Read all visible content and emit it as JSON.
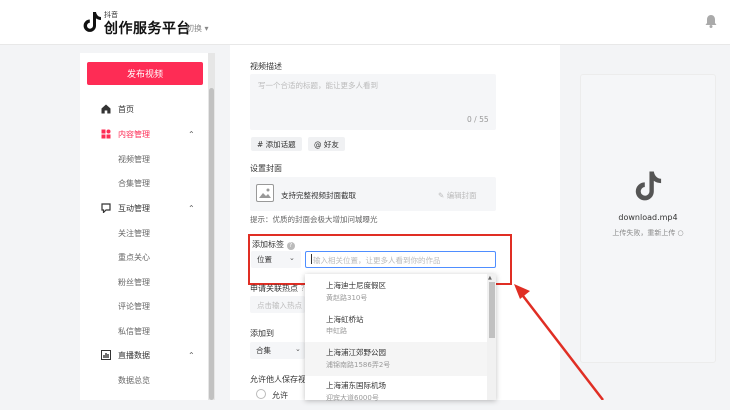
{
  "header": {
    "brand_small": "抖音",
    "brand_title": "创作服务平台",
    "switch_label": "切换",
    "switch_caret": "▾"
  },
  "sidebar": {
    "publish_button": "发布视频",
    "items": [
      {
        "label": "首页",
        "icon": "home-icon"
      },
      {
        "label": "内容管理",
        "icon": "grid-icon",
        "caret": "⌃",
        "active": true
      },
      {
        "label": "视频管理"
      },
      {
        "label": "合集管理"
      },
      {
        "label": "互动管理",
        "icon": "interaction-icon",
        "caret": "⌃"
      },
      {
        "label": "关注管理"
      },
      {
        "label": "重点关心"
      },
      {
        "label": "粉丝管理"
      },
      {
        "label": "评论管理"
      },
      {
        "label": "私信管理"
      },
      {
        "label": "直播数据",
        "icon": "chart-icon",
        "caret": "⌃"
      },
      {
        "label": "数据总览"
      }
    ]
  },
  "form": {
    "desc_label": "视频描述",
    "desc_placeholder": "写一个合适的标题，能让更多人看到",
    "desc_count": "0 / 55",
    "chip_topic": "# 添加话题",
    "chip_friend": "@ 好友",
    "cover_label": "设置封面",
    "cover_text": "支持完整视频封面截取",
    "cover_edit": "编辑封面",
    "cover_hint": "提示：优质的封面会极大增加问城曝光",
    "tag_label": "添加标签",
    "tag_select": "位置",
    "tag_placeholder": "输入相关位置，让更多人看到你的作品",
    "hotspot_label": "申请关联热点",
    "hotspot_placeholder": "点击输入热点",
    "add_to_label": "添加到",
    "add_to_select": "合集",
    "allow_save_label": "允许他人保存视",
    "allow_option": "允许"
  },
  "dropdown": {
    "items": [
      {
        "title": "上海迪士尼度假区",
        "sub": "黄赵路310号"
      },
      {
        "title": "上海虹桥站",
        "sub": "申虹路"
      },
      {
        "title": "上海浦江郊野公园",
        "sub": "浦锦南路1586弄2号",
        "highlight": true
      },
      {
        "title": "上海浦东国际机场",
        "sub": "迎宾大道6000号"
      }
    ]
  },
  "preview": {
    "file_name": "download.mp4",
    "status": "上传失败，重新上传 ○"
  },
  "colors": {
    "brand": "#fe2c55",
    "annotation": "#e02e24",
    "focus": "#4f8eff"
  }
}
